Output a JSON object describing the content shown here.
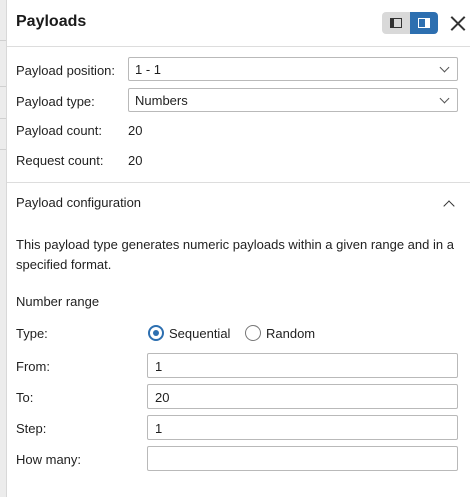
{
  "header": {
    "title": "Payloads"
  },
  "payload_sets": {
    "position_label": "Payload position:",
    "position_value": "1 - 1",
    "type_label": "Payload type:",
    "type_value": "Numbers",
    "count_label": "Payload count:",
    "count_value": "20",
    "request_label": "Request count:",
    "request_value": "20"
  },
  "config": {
    "title": "Payload configuration",
    "description": "This payload type generates numeric payloads within a given range and in a specified format.",
    "range_heading": "Number range",
    "type_label": "Type:",
    "type_options": [
      "Sequential",
      "Random"
    ],
    "type_selected": "Sequential",
    "from_label": "From:",
    "from_value": "1",
    "to_label": "To:",
    "to_value": "20",
    "step_label": "Step:",
    "step_value": "1",
    "howmany_label": "How many:",
    "howmany_value": ""
  },
  "colors": {
    "accent": "#2d6fb0",
    "toggle_off": "#d9d9d9"
  }
}
